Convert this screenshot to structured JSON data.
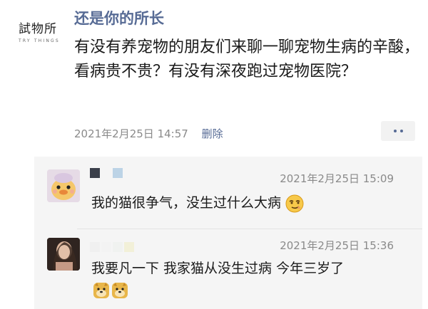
{
  "logo": {
    "main": "試物所",
    "sub": "TRY THINGS"
  },
  "post": {
    "author": "还是你的所长",
    "text": "有没有养宠物的朋友们来聊一聊宠物生病的辛酸，看病贵不贵？有没有深夜跑过宠物医院？",
    "timestamp": "2021年2月25日 14:57",
    "delete_label": "删除",
    "more_icon": "more-dots-icon"
  },
  "comments": [
    {
      "timestamp": "2021年2月25日 15:09",
      "text": "我的猫很争气，没生过什么大病",
      "emoji": "smirk-face-emoji"
    },
    {
      "timestamp": "2021年2月25日 15:36",
      "text": "我要凡一下 我家猫从没生过病 今年三岁了",
      "emoji": "doge-emoji"
    }
  ],
  "colors": {
    "link": "#576b95",
    "meta": "#8a8a8a",
    "comment_bg": "#f5f5f5"
  }
}
